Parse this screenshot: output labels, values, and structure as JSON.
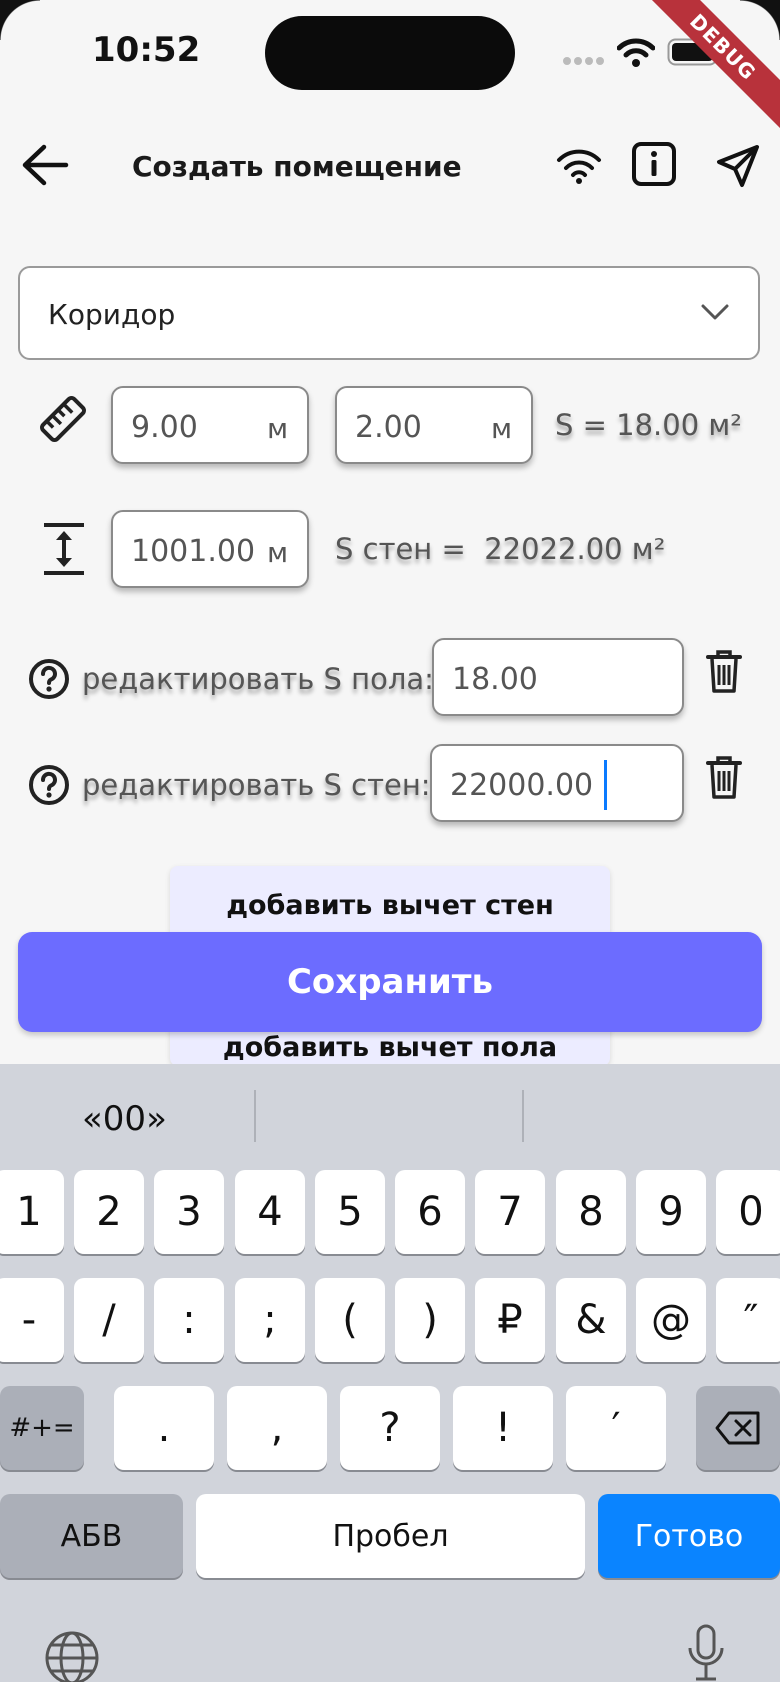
{
  "status_bar": {
    "time": "10:52",
    "debug_label": "DEBUG"
  },
  "app_bar": {
    "title": "Создать помещение"
  },
  "room_type": {
    "selected": "Коридор"
  },
  "dimensions": {
    "length": "9.00",
    "length_unit": "м",
    "width": "2.00",
    "width_unit": "м",
    "area_text": "S = 18.00 м²",
    "height": "1001.00",
    "height_unit": "м",
    "walls_area_text": "S стен =  22022.00 м²"
  },
  "edit_floor": {
    "label": "редактировать S пола:",
    "value": "18.00"
  },
  "edit_walls": {
    "label": "редактировать S стен:",
    "value": "22000.00"
  },
  "deductions": {
    "walls_label": "добавить вычет стен",
    "floor_label": "добавить вычет пола"
  },
  "save_button": {
    "label": "Сохранить"
  },
  "keyboard": {
    "suggestion": "«00»",
    "row1": [
      "1",
      "2",
      "3",
      "4",
      "5",
      "6",
      "7",
      "8",
      "9",
      "0"
    ],
    "row2": [
      "-",
      "/",
      ":",
      ";",
      "(",
      ")",
      "₽",
      "&",
      "@",
      "″"
    ],
    "row3": [
      ".",
      ",",
      "?",
      "!",
      "′"
    ],
    "symbols_key": "#+=",
    "abc_key": "АБВ",
    "space_key": "Пробел",
    "done_key": "Готово"
  },
  "colors": {
    "accent": "#6c6cff",
    "panel": "#ececff",
    "keyboard_bg": "#d1d4db",
    "done_key": "#0a84ff"
  }
}
